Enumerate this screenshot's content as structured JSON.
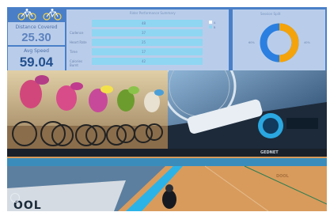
{
  "dashboard": {
    "icons": [
      "bicycle-icon",
      "bicycle-icon"
    ],
    "kpis": [
      {
        "label": "Distance Covered",
        "value": "25.30"
      },
      {
        "label": "Avg Speed",
        "value": "59.04"
      }
    ],
    "table": {
      "title": "Rider Performance Summary",
      "rows": [
        {
          "label": "",
          "value": "48"
        },
        {
          "label": "Cadence",
          "value": "37"
        },
        {
          "label": "Heart Rate",
          "value": "25"
        },
        {
          "label": "Time",
          "value": "17"
        },
        {
          "label": "Calories Burnt",
          "value": "42"
        }
      ],
      "legend": [
        {
          "label": "A",
          "color": "#ffffff"
        },
        {
          "label": "B",
          "color": "#8fd6f2"
        }
      ]
    },
    "donut": {
      "title": "Session Split",
      "left_label": "60%",
      "right_label": "40%",
      "colors": [
        "#f5a30a",
        "#2b7fe0"
      ]
    }
  },
  "velodrome": {
    "hud_label": "GEDNET",
    "banner_text": "OOL",
    "watermark": "DOOL"
  }
}
